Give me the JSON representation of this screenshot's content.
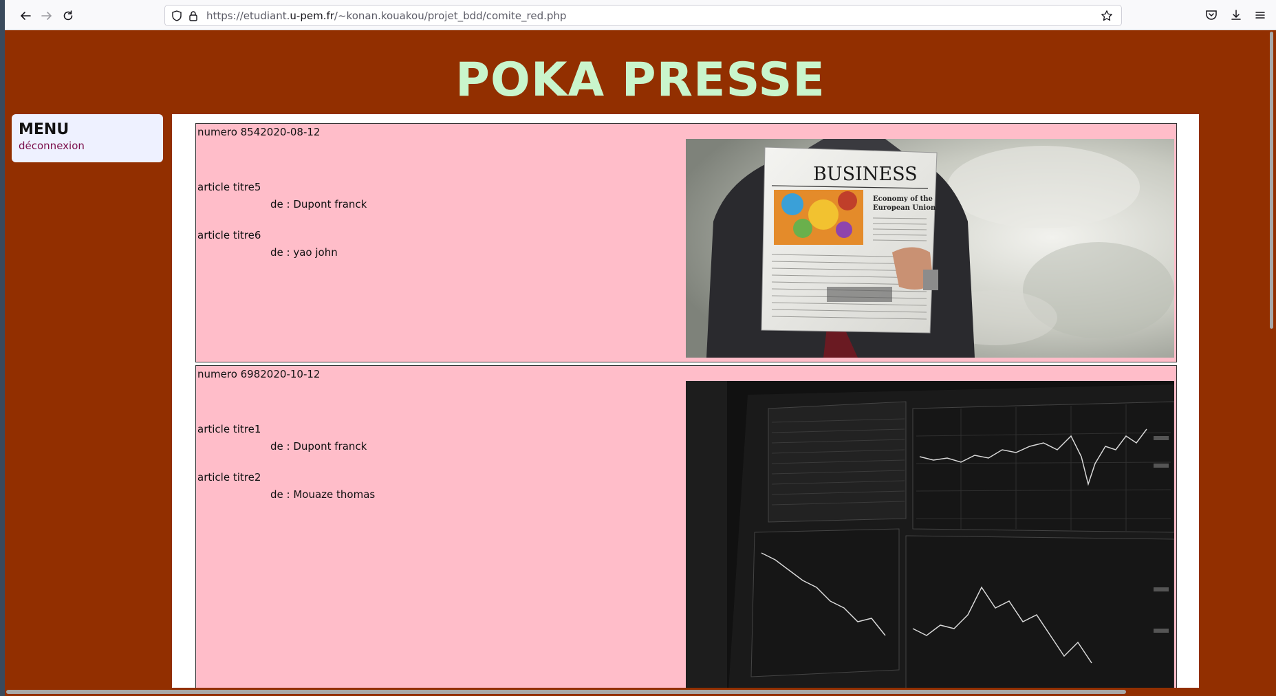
{
  "browser": {
    "url_prefix": "https://etudiant.",
    "url_domain": "u-pem.fr",
    "url_path": "/~konan.kouakou/projet_bdd/comite_red.php"
  },
  "site": {
    "title": "POKA PRESSE"
  },
  "menu": {
    "title": "MENU",
    "logout_label": "déconnexion"
  },
  "issues": [
    {
      "label": "numero 8542020-08-12",
      "articles": [
        {
          "title": "article titre5",
          "author": "de : Dupont franck"
        },
        {
          "title": "article titre6",
          "author": "de : yao john"
        }
      ],
      "image": {
        "headline": "BUSINESS",
        "subhead_1": "Economy of the",
        "subhead_2": "European Union"
      }
    },
    {
      "label": "numero 6982020-10-12",
      "articles": [
        {
          "title": "article titre1",
          "author": "de : Dupont franck"
        },
        {
          "title": "article titre2",
          "author": "de : Mouaze thomas"
        }
      ],
      "image": {}
    }
  ],
  "colors": {
    "page_background": "#922f00",
    "title_color": "#c9f5cc",
    "issue_background": "#ffbdc9",
    "menu_background": "#eef1ff",
    "link_color": "#7a0d4a"
  }
}
